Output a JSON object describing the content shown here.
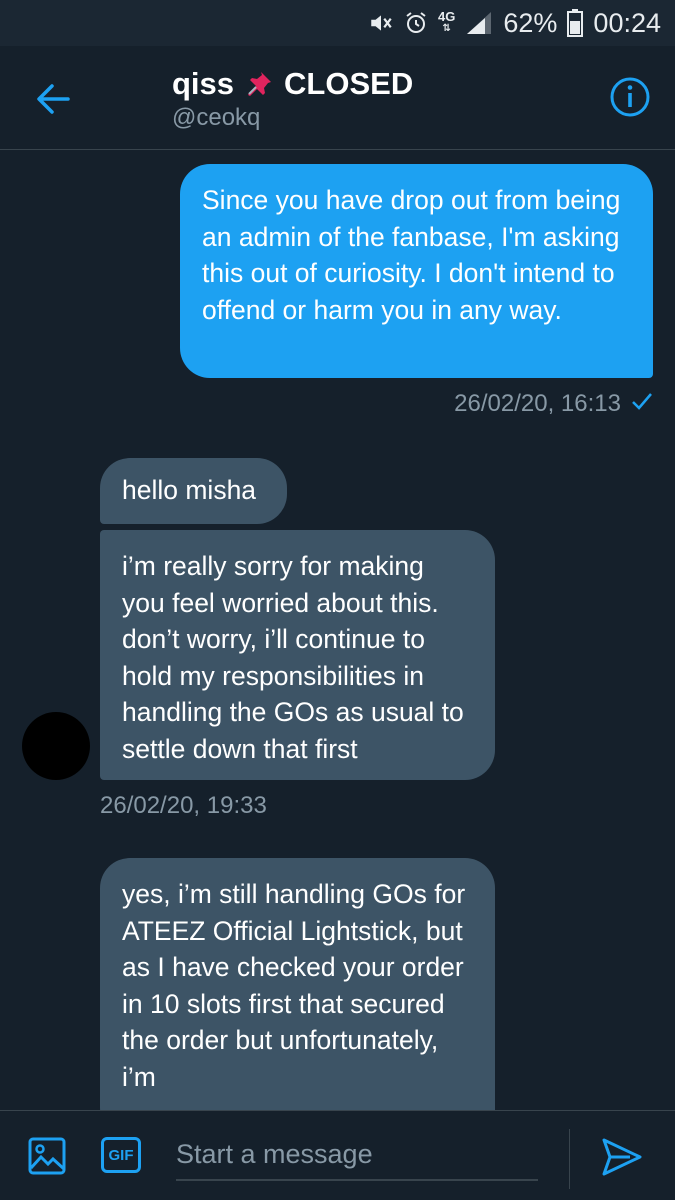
{
  "status_bar": {
    "network": "4G",
    "battery": "62%",
    "time": "00:24",
    "icons": [
      "mute-icon",
      "alarm-icon",
      "signal-icon",
      "battery-icon"
    ]
  },
  "header": {
    "name": "qiss",
    "pin_icon": "pushpin-icon",
    "status": "CLOSED",
    "handle": "@ceokq"
  },
  "messages": {
    "sent_1": "Since you have drop out from being an admin of the fanbase, I'm asking this out of curiosity. I don't intend to offend or harm you in any way.",
    "sent_1_time": "26/02/20, 16:13",
    "recv_1": "hello misha",
    "recv_2": "i’m really sorry for making you feel worried about this. don’t worry, i’ll continue to hold my responsibilities in handling the GOs as usual to settle down that first",
    "recv_time": "26/02/20, 19:33",
    "recv_3": "yes, i’m still handling GOs for ATEEZ Official Lightstick, but as I have checked your order in 10 slots first that secured the order but unfortunately, i’m"
  },
  "compose": {
    "placeholder": "Start a message",
    "gif_label": "GIF"
  },
  "colors": {
    "background": "#15202b",
    "accent": "#1da1f2",
    "received_bubble": "#3d5466",
    "muted_text": "#8899a6"
  }
}
